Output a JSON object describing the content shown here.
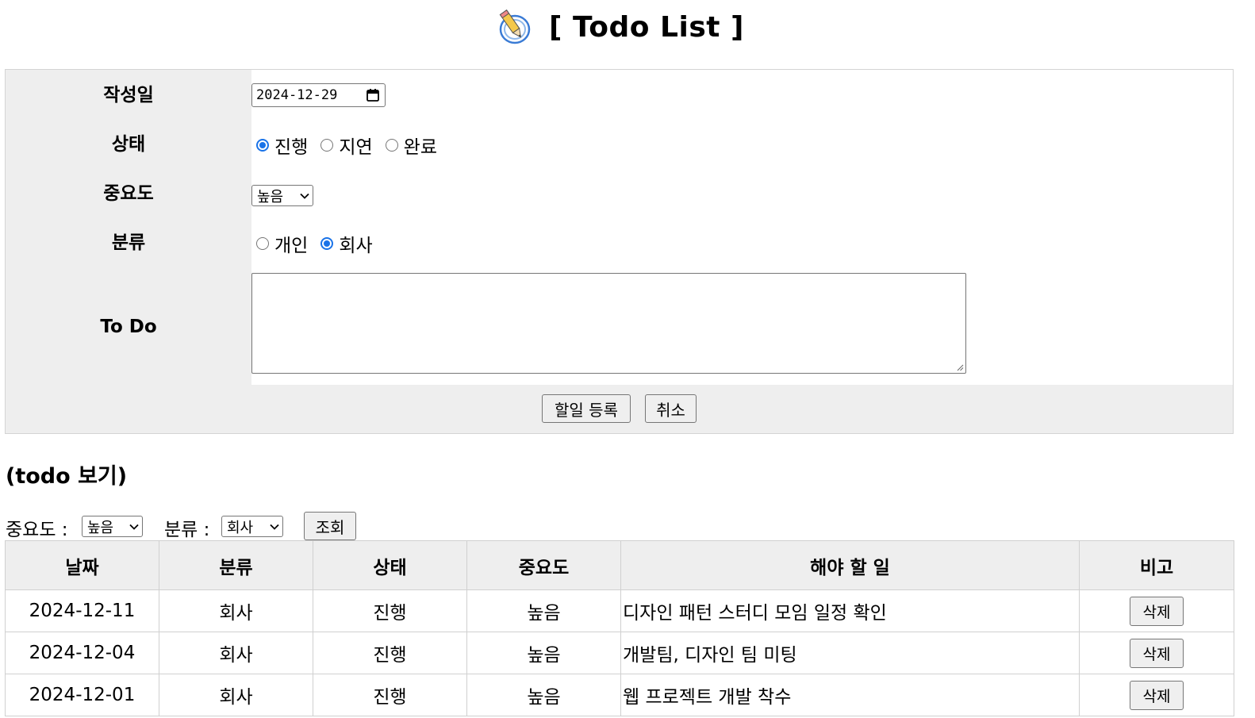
{
  "header": {
    "title": "[ Todo List ]",
    "icon": "pencil-icon"
  },
  "form": {
    "date_label": "작성일",
    "date_value": "2024-12-29",
    "status_label": "상태",
    "status_options": [
      "진행",
      "지연",
      "완료"
    ],
    "status_selected": "진행",
    "importance_label": "중요도",
    "importance_value": "높음",
    "category_label": "분류",
    "category_options": [
      "개인",
      "회사"
    ],
    "category_selected": "회사",
    "todo_label": "To Do",
    "todo_value": "",
    "submit_label": "할일 등록",
    "cancel_label": "취소"
  },
  "view": {
    "section_title": "(todo 보기)",
    "importance_label": "중요도 :",
    "importance_value": "높음",
    "category_label": "분류 :",
    "category_value": "회사",
    "search_label": "조회"
  },
  "table": {
    "headers": [
      "날짜",
      "분류",
      "상태",
      "중요도",
      "해야 할 일",
      "비고"
    ],
    "rows": [
      {
        "date": "2024-12-11",
        "category": "회사",
        "status": "진행",
        "importance": "높음",
        "task": "디자인 패턴 스터디 모임 일정 확인",
        "action": "삭제"
      },
      {
        "date": "2024-12-04",
        "category": "회사",
        "status": "진행",
        "importance": "높음",
        "task": "개발팀, 디자인 팀 미팅",
        "action": "삭제"
      },
      {
        "date": "2024-12-01",
        "category": "회사",
        "status": "진행",
        "importance": "높음",
        "task": "웹 프로젝트 개발 착수",
        "action": "삭제"
      }
    ]
  },
  "colors": {
    "accent": "#1a73e8",
    "panel": "#eeeeee",
    "border": "#d0d0d0"
  }
}
